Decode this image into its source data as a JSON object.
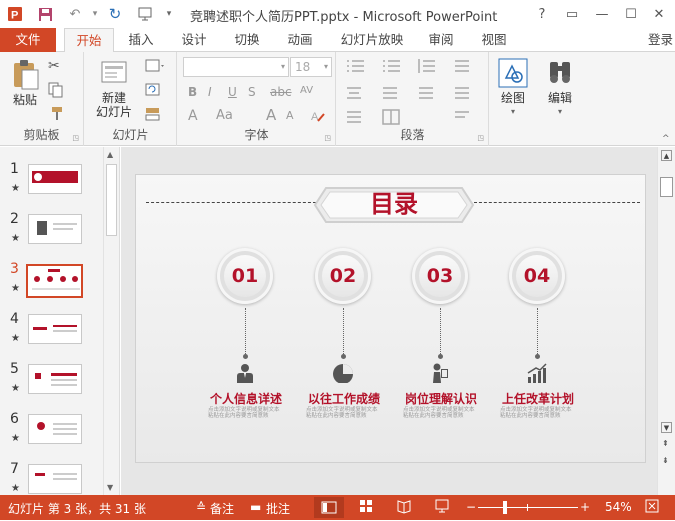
{
  "window": {
    "title": "竞聘述职个人简历PPT.pptx - Microsoft PowerPoint",
    "help": "?",
    "ribbon_display": "▭",
    "minimize": "—",
    "maximize": "☐",
    "close": "✕"
  },
  "quick_access": {
    "undo_dropdown": "▾",
    "customize": "▾"
  },
  "tabs": [
    "文件",
    "开始",
    "插入",
    "设计",
    "切换",
    "动画",
    "幻灯片放映",
    "审阅",
    "视图"
  ],
  "active_tab": "开始",
  "login": "登录",
  "ribbon": {
    "clipboard": {
      "label": "剪贴板",
      "paste": "粘贴"
    },
    "slides": {
      "label": "幻灯片",
      "new_slide_line1": "新建",
      "new_slide_line2": "幻灯片"
    },
    "font": {
      "label": "字体",
      "size": "18",
      "bold": "B",
      "italic": "I",
      "underline": "U",
      "shadow": "S",
      "strike": "abc",
      "spacing": "AV",
      "color": "A",
      "case": "Aa",
      "grow": "A",
      "shrink": "A"
    },
    "paragraph": {
      "label": "段落"
    },
    "drawing": {
      "label": "绘图"
    },
    "editing": {
      "label": "编辑"
    }
  },
  "thumbnails": [
    {
      "num": "1",
      "selected": false
    },
    {
      "num": "2",
      "selected": false
    },
    {
      "num": "3",
      "selected": true
    },
    {
      "num": "4",
      "selected": false
    },
    {
      "num": "5",
      "selected": false
    },
    {
      "num": "6",
      "selected": false
    },
    {
      "num": "7",
      "selected": false
    }
  ],
  "slide": {
    "heading": "目录",
    "items": [
      {
        "num": "01",
        "title": "个人信息详述",
        "desc": "点击添加文字说明或复制文本粘贴在此内容要言简意赅"
      },
      {
        "num": "02",
        "title": "以往工作成绩",
        "desc": "点击添加文字说明或复制文本粘贴在此内容要言简意赅"
      },
      {
        "num": "03",
        "title": "岗位理解认识",
        "desc": "点击添加文字说明或复制文本粘贴在此内容要言简意赅"
      },
      {
        "num": "04",
        "title": "上任改革计划",
        "desc": "点击添加文字说明或复制文本粘贴在此内容要言简意赅"
      }
    ]
  },
  "status": {
    "slide_info": "幻灯片 第 3 张，共 31 张",
    "notes": "备注",
    "comments": "批注",
    "zoom_minus": "−",
    "zoom_plus": "+",
    "zoom": "54%",
    "zoom_fraction": 0.54
  },
  "colors": {
    "accent": "#d24726",
    "slide_red": "#b3122a"
  }
}
